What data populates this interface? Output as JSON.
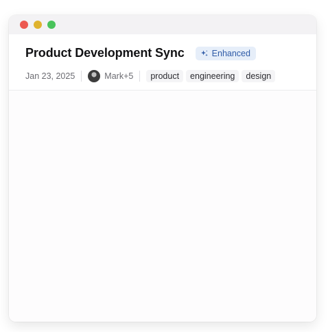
{
  "window": {
    "controls": [
      "close",
      "minimize",
      "zoom"
    ]
  },
  "note": {
    "title": "Product Development Sync",
    "badge": {
      "label": "Enhanced",
      "icon": "sparkle-icon"
    },
    "date": "Jan 23, 2025",
    "participants": {
      "name": "Mark",
      "extra": "+5"
    },
    "tags": [
      "product",
      "engineering",
      "design"
    ]
  },
  "colors": {
    "badge_bg": "#e6eef9",
    "badge_text": "#2f5ba7",
    "close": "#ec5850",
    "minimize": "#dfb32e",
    "zoom": "#49c35b"
  }
}
